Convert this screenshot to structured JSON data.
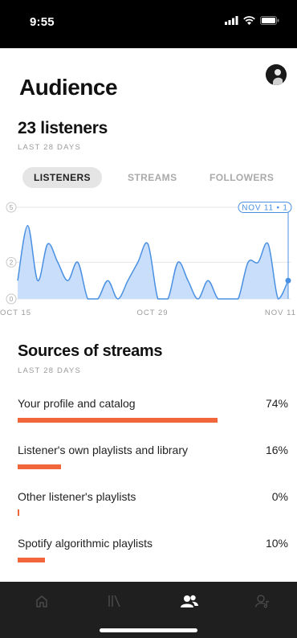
{
  "status_bar": {
    "time": "9:55"
  },
  "header": {
    "title": "Audience"
  },
  "summary": {
    "count_label": "23 listeners",
    "period": "LAST 28 DAYS"
  },
  "tabs": [
    {
      "label": "LISTENERS",
      "active": true
    },
    {
      "label": "STREAMS",
      "active": false
    },
    {
      "label": "FOLLOWERS",
      "active": false
    }
  ],
  "chart_data": {
    "type": "area",
    "x": [
      "Oct 15",
      "Oct 16",
      "Oct 17",
      "Oct 18",
      "Oct 19",
      "Oct 20",
      "Oct 21",
      "Oct 22",
      "Oct 23",
      "Oct 24",
      "Oct 25",
      "Oct 26",
      "Oct 27",
      "Oct 28",
      "Oct 29",
      "Oct 30",
      "Oct 31",
      "Nov 1",
      "Nov 2",
      "Nov 3",
      "Nov 4",
      "Nov 5",
      "Nov 6",
      "Nov 7",
      "Nov 8",
      "Nov 9",
      "Nov 10",
      "Nov 11"
    ],
    "values": [
      1,
      4,
      1,
      3,
      2,
      1,
      2,
      0,
      0,
      1,
      0,
      1,
      2,
      3,
      0,
      0,
      2,
      1,
      0,
      1,
      0,
      0,
      0,
      2,
      2,
      3,
      0,
      1
    ],
    "ylim": [
      0,
      5
    ],
    "ytick_labels": [
      "0",
      "2",
      "5"
    ],
    "xtick_labels": [
      "OCT 15",
      "OCT 29",
      "NOV 11"
    ],
    "tooltip": "NOV 11 • 1",
    "color": "#4a90e2",
    "fill_color": "#c8defa"
  },
  "sources": {
    "title": "Sources of streams",
    "period": "LAST 28 DAYS",
    "items": [
      {
        "label": "Your profile and catalog",
        "percent_text": "74%",
        "value": 74
      },
      {
        "label": "Listener's own playlists and library",
        "percent_text": "16%",
        "value": 16
      },
      {
        "label": "Other listener's playlists",
        "percent_text": "0%",
        "value": 0
      },
      {
        "label": "Spotify algorithmic playlists",
        "percent_text": "10%",
        "value": 10
      }
    ],
    "bar_color": "#f2663c"
  },
  "bottom_nav": [
    {
      "icon": "home-icon",
      "active": false
    },
    {
      "icon": "library-icon",
      "active": false
    },
    {
      "icon": "audience-icon",
      "active": true
    },
    {
      "icon": "profile-icon",
      "active": false
    }
  ]
}
